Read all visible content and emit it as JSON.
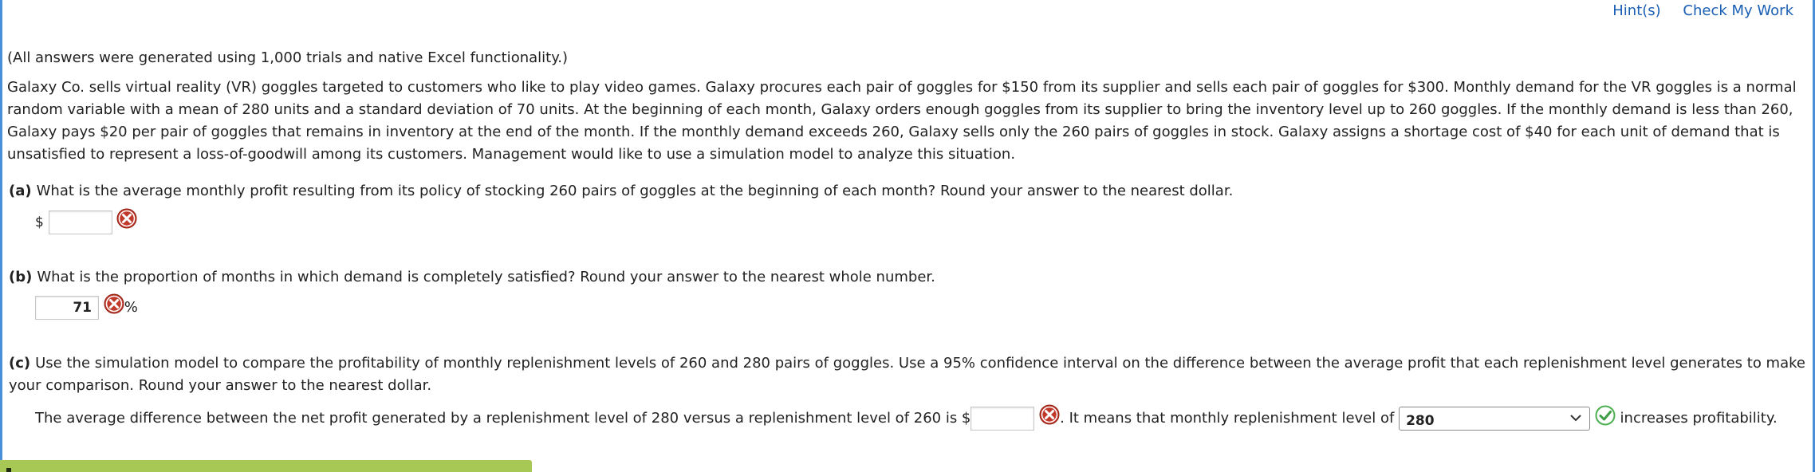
{
  "toolbar": {
    "hints_label": "Hint(s)",
    "check_label": "Check My Work"
  },
  "intro": {
    "note": "(All answers were generated using 1,000 trials and native Excel functionality.)",
    "problem": "Galaxy Co. sells virtual reality (VR) goggles targeted to customers who like to play video games. Galaxy procures each pair of goggles for $150 from its supplier and sells each pair of goggles for $300. Monthly demand for the VR goggles is a normal random variable with a mean of 280 units and a standard deviation of 70 units. At the beginning of each month, Galaxy orders enough goggles from its supplier to bring the inventory level up to 260 goggles. If the monthly demand is less than 260, Galaxy pays $20 per pair of goggles that remains in inventory at the end of the month. If the monthly demand exceeds 260, Galaxy sells only the 260 pairs of goggles in stock. Galaxy assigns a shortage cost of $40 for each unit of demand that is unsatisfied to represent a loss-of-goodwill among its customers. Management would like to use a simulation model to analyze this situation."
  },
  "questions": {
    "a": {
      "part": "(a)",
      "text": "What is the average monthly profit resulting from its policy of stocking 260 pairs of goggles at the beginning of each month? Round your answer to the nearest dollar.",
      "prefix": "$",
      "value": "",
      "status": "incorrect"
    },
    "b": {
      "part": "(b)",
      "text": "What is the proportion of months in which demand is completely satisfied? Round your answer to the nearest whole number.",
      "value": "71",
      "suffix": "%",
      "status": "incorrect"
    },
    "c": {
      "part": "(c)",
      "text": "Use the simulation model to compare the profitability of monthly replenishment levels of 260 and 280 pairs of goggles. Use a 95% confidence interval on the difference between the average profit that each replenishment level generates to make your comparison. Round your answer to the nearest dollar.",
      "sentence_start": "The average difference between the net profit generated by a replenishment level of 280 versus a replenishment level of 260 is $",
      "value": "",
      "sentence_mid": ". It means that monthly replenishment level of",
      "select_value": "280",
      "sentence_end": "increases profitability.",
      "input_status": "incorrect",
      "select_status": "correct"
    }
  },
  "colors": {
    "link": "#1a5fb4",
    "incorrect": "#c0392b",
    "correct": "#4caf50",
    "footer_bar": "#a7c855",
    "frame": "#4a90d9"
  }
}
